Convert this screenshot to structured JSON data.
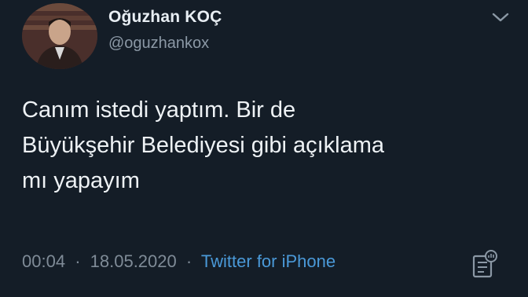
{
  "author": {
    "display_name": "Oğuzhan KOÇ",
    "handle": "@oguzhankox"
  },
  "tweet": {
    "lines": [
      "Canım istedi yaptım. Bir de",
      "Büyükşehir Belediyesi gibi açıklama",
      "mı yapayım"
    ],
    "time": "00:04",
    "separator": "·",
    "date": "18.05.2020",
    "source": "Twitter for iPhone"
  },
  "icons": {
    "menu": "chevron-down-icon",
    "analytics": "analytics-icon"
  },
  "colors": {
    "background": "#141d27",
    "text": "#eef2f5",
    "secondary": "#8b98a5",
    "link": "#4a99d8"
  }
}
